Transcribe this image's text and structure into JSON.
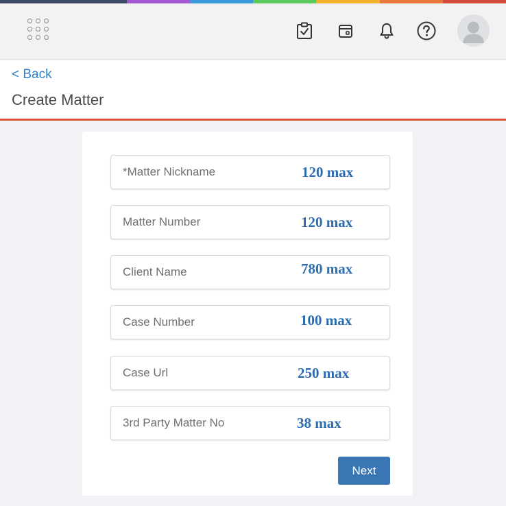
{
  "brand_stripe_colors": [
    "#3c4a63",
    "#3c4a63",
    "#a259d1",
    "#3b9ad9",
    "#5bc95b",
    "#f2b02e",
    "#e57a3a",
    "#d24c3a"
  ],
  "topbar": {
    "icons": [
      "apps-grid-icon",
      "tasks-checklist-icon",
      "calendar-icon",
      "notifications-bell-icon",
      "help-icon",
      "user-avatar"
    ]
  },
  "header": {
    "back_label": "< Back",
    "title": "Create Matter",
    "accent_color": "#e0533b"
  },
  "form": {
    "fields": [
      {
        "label": "*Matter Nickname",
        "max_hint": "120 max"
      },
      {
        "label": "Matter Number",
        "max_hint": "120 max"
      },
      {
        "label": "Client Name",
        "max_hint": "780 max"
      },
      {
        "label": "Case Number",
        "max_hint": "100 max"
      },
      {
        "label": "Case Url",
        "max_hint": "250 max"
      },
      {
        "label": "3rd Party Matter No",
        "max_hint": "38 max"
      }
    ],
    "next_label": "Next",
    "button_color": "#3a76b3",
    "hint_color": "#2c6cb0"
  }
}
